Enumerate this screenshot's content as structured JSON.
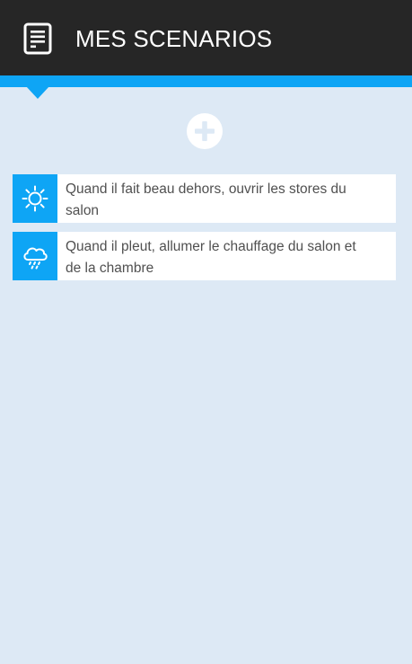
{
  "header": {
    "title": "MES SCENARIOS",
    "icon": "document-list-icon"
  },
  "colors": {
    "header_bg": "#262626",
    "accent": "#0ea5f5",
    "page_bg": "#dde9f5",
    "card_bg": "#ffffff",
    "text": "#505050"
  },
  "add_button": {
    "icon": "plus-circle-icon"
  },
  "scenarios": [
    {
      "icon": "sun-icon",
      "text": "Quand il fait beau dehors, ouvrir les stores du salon"
    },
    {
      "icon": "rain-cloud-icon",
      "text": "Quand il pleut, allumer le chauffage du salon et de la chambre"
    }
  ]
}
